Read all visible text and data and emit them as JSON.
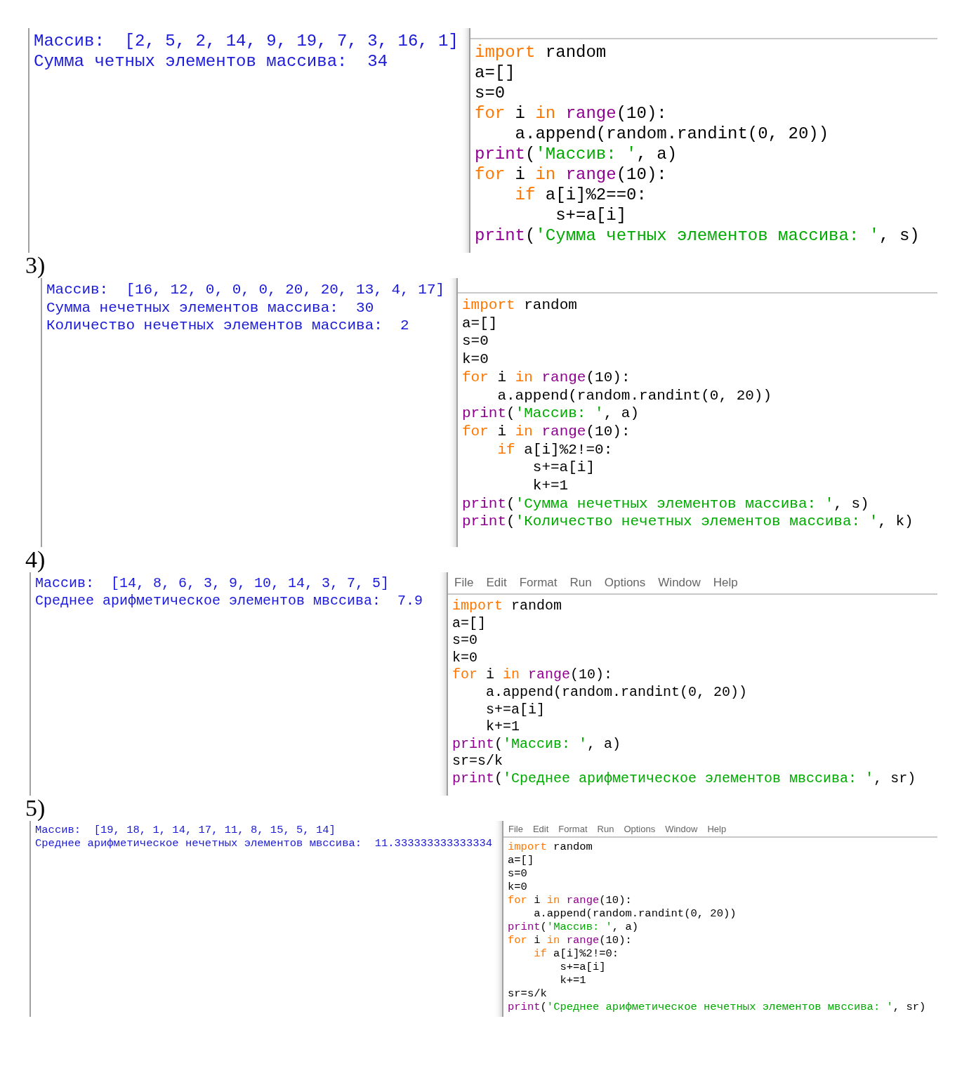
{
  "sections": [
    {
      "shell_output": [
        "Массив:  [2, 5, 2, 14, 9, 19, 7, 3, 16, 1]",
        "Сумма четных элементов массива:  34"
      ],
      "editor": {
        "code": [
          [
            {
              "kind": "keyword",
              "text": "import"
            },
            {
              "kind": "plain",
              "text": " random"
            }
          ],
          [
            {
              "kind": "plain",
              "text": "a=[]"
            }
          ],
          [
            {
              "kind": "plain",
              "text": "s=0"
            }
          ],
          [
            {
              "kind": "keyword",
              "text": "for"
            },
            {
              "kind": "plain",
              "text": " i "
            },
            {
              "kind": "keyword",
              "text": "in"
            },
            {
              "kind": "builtin",
              "text": " range"
            },
            {
              "kind": "plain",
              "text": "(10):"
            }
          ],
          [
            {
              "kind": "plain",
              "text": "    a.append(random.randint(0, 20))"
            }
          ],
          [
            {
              "kind": "builtin",
              "text": "print"
            },
            {
              "kind": "plain",
              "text": "("
            },
            {
              "kind": "string",
              "text": "'Массив: '"
            },
            {
              "kind": "plain",
              "text": ", a)"
            }
          ],
          [
            {
              "kind": "keyword",
              "text": "for"
            },
            {
              "kind": "plain",
              "text": " i "
            },
            {
              "kind": "keyword",
              "text": "in"
            },
            {
              "kind": "builtin",
              "text": " range"
            },
            {
              "kind": "plain",
              "text": "(10):"
            }
          ],
          [
            {
              "kind": "keyword",
              "text": "    if"
            },
            {
              "kind": "plain",
              "text": " a[i]%2==0:"
            }
          ],
          [
            {
              "kind": "plain",
              "text": "        s+=a[i]"
            }
          ],
          [
            {
              "kind": "builtin",
              "text": "print"
            },
            {
              "kind": "plain",
              "text": "("
            },
            {
              "kind": "string",
              "text": "'Сумма четных элементов массива: '"
            },
            {
              "kind": "plain",
              "text": ", s)"
            }
          ]
        ]
      }
    },
    {
      "label": "3)",
      "shell_output": [
        "Массив:  [16, 12, 0, 0, 0, 20, 20, 13, 4, 17]",
        "Сумма нечетных элементов массива:  30",
        "Количество нечетных элементов массива:  2"
      ],
      "editor": {
        "code": [
          [
            {
              "kind": "keyword",
              "text": "import"
            },
            {
              "kind": "plain",
              "text": " random"
            }
          ],
          [
            {
              "kind": "plain",
              "text": "a=[]"
            }
          ],
          [
            {
              "kind": "plain",
              "text": "s=0"
            }
          ],
          [
            {
              "kind": "plain",
              "text": "k=0"
            }
          ],
          [
            {
              "kind": "keyword",
              "text": "for"
            },
            {
              "kind": "plain",
              "text": " i "
            },
            {
              "kind": "keyword",
              "text": "in"
            },
            {
              "kind": "builtin",
              "text": " range"
            },
            {
              "kind": "plain",
              "text": "(10):"
            }
          ],
          [
            {
              "kind": "plain",
              "text": "    a.append(random.randint(0, 20))"
            }
          ],
          [
            {
              "kind": "builtin",
              "text": "print"
            },
            {
              "kind": "plain",
              "text": "("
            },
            {
              "kind": "string",
              "text": "'Массив: '"
            },
            {
              "kind": "plain",
              "text": ", a)"
            }
          ],
          [
            {
              "kind": "keyword",
              "text": "for"
            },
            {
              "kind": "plain",
              "text": " i "
            },
            {
              "kind": "keyword",
              "text": "in"
            },
            {
              "kind": "builtin",
              "text": " range"
            },
            {
              "kind": "plain",
              "text": "(10):"
            }
          ],
          [
            {
              "kind": "keyword",
              "text": "    if"
            },
            {
              "kind": "plain",
              "text": " a[i]%2!=0:"
            }
          ],
          [
            {
              "kind": "plain",
              "text": "        s+=a[i]"
            }
          ],
          [
            {
              "kind": "plain",
              "text": "        k+=1"
            }
          ],
          [
            {
              "kind": "builtin",
              "text": "print"
            },
            {
              "kind": "plain",
              "text": "("
            },
            {
              "kind": "string",
              "text": "'Сумма нечетных элементов массива: '"
            },
            {
              "kind": "plain",
              "text": ", s)"
            }
          ],
          [
            {
              "kind": "builtin",
              "text": "print"
            },
            {
              "kind": "plain",
              "text": "("
            },
            {
              "kind": "string",
              "text": "'Количество нечетных элементов массива: '"
            },
            {
              "kind": "plain",
              "text": ", k)"
            }
          ]
        ]
      }
    },
    {
      "label": "4)",
      "shell_output": [
        "Массив:  [14, 8, 6, 3, 9, 10, 14, 3, 7, 5]",
        "Среднее арифметическое элементов мвссива:  7.9"
      ],
      "editor": {
        "menu": [
          "File",
          "Edit",
          "Format",
          "Run",
          "Options",
          "Window",
          "Help"
        ],
        "code": [
          [
            {
              "kind": "keyword",
              "text": "import"
            },
            {
              "kind": "plain",
              "text": " random"
            }
          ],
          [
            {
              "kind": "plain",
              "text": "a=[]"
            }
          ],
          [
            {
              "kind": "plain",
              "text": "s=0"
            }
          ],
          [
            {
              "kind": "plain",
              "text": "k=0"
            }
          ],
          [
            {
              "kind": "keyword",
              "text": "for"
            },
            {
              "kind": "plain",
              "text": " i "
            },
            {
              "kind": "keyword",
              "text": "in"
            },
            {
              "kind": "builtin",
              "text": " range"
            },
            {
              "kind": "plain",
              "text": "(10):"
            }
          ],
          [
            {
              "kind": "plain",
              "text": "    a.append(random.randint(0, 20))"
            }
          ],
          [
            {
              "kind": "plain",
              "text": "    s+=a[i]"
            }
          ],
          [
            {
              "kind": "plain",
              "text": "    k+=1"
            }
          ],
          [
            {
              "kind": "builtin",
              "text": "print"
            },
            {
              "kind": "plain",
              "text": "("
            },
            {
              "kind": "string",
              "text": "'Массив: '"
            },
            {
              "kind": "plain",
              "text": ", a)"
            }
          ],
          [
            {
              "kind": "plain",
              "text": "sr=s/k"
            }
          ],
          [
            {
              "kind": "builtin",
              "text": "print"
            },
            {
              "kind": "plain",
              "text": "("
            },
            {
              "kind": "string",
              "text": "'Среднее арифметическое элементов мвссива: '"
            },
            {
              "kind": "plain",
              "text": ", sr)"
            }
          ]
        ]
      }
    },
    {
      "label": "5)",
      "shell_output": [
        "Массив:  [19, 18, 1, 14, 17, 11, 8, 15, 5, 14]",
        "Среднее арифметическое нечетных элементов мвссива:  11.333333333333334"
      ],
      "editor": {
        "menu": [
          "File",
          "Edit",
          "Format",
          "Run",
          "Options",
          "Window",
          "Help"
        ],
        "code": [
          [
            {
              "kind": "keyword",
              "text": "import"
            },
            {
              "kind": "plain",
              "text": " random"
            }
          ],
          [
            {
              "kind": "plain",
              "text": "a=[]"
            }
          ],
          [
            {
              "kind": "plain",
              "text": "s=0"
            }
          ],
          [
            {
              "kind": "plain",
              "text": "k=0"
            }
          ],
          [
            {
              "kind": "keyword",
              "text": "for"
            },
            {
              "kind": "plain",
              "text": " i "
            },
            {
              "kind": "keyword",
              "text": "in"
            },
            {
              "kind": "builtin",
              "text": " range"
            },
            {
              "kind": "plain",
              "text": "(10):"
            }
          ],
          [
            {
              "kind": "plain",
              "text": "    a.append(random.randint(0, 20))"
            }
          ],
          [
            {
              "kind": "builtin",
              "text": "print"
            },
            {
              "kind": "plain",
              "text": "("
            },
            {
              "kind": "string",
              "text": "'Массив: '"
            },
            {
              "kind": "plain",
              "text": ", a)"
            }
          ],
          [
            {
              "kind": "keyword",
              "text": "for"
            },
            {
              "kind": "plain",
              "text": " i "
            },
            {
              "kind": "keyword",
              "text": "in"
            },
            {
              "kind": "builtin",
              "text": " range"
            },
            {
              "kind": "plain",
              "text": "(10):"
            }
          ],
          [
            {
              "kind": "keyword",
              "text": "    if"
            },
            {
              "kind": "plain",
              "text": " a[i]%2!=0:"
            }
          ],
          [
            {
              "kind": "plain",
              "text": "        s+=a[i]"
            }
          ],
          [
            {
              "kind": "plain",
              "text": "        k+=1"
            }
          ],
          [
            {
              "kind": "plain",
              "text": "sr=s/k"
            }
          ],
          [
            {
              "kind": "builtin",
              "text": "print"
            },
            {
              "kind": "plain",
              "text": "("
            },
            {
              "kind": "string",
              "text": "'Среднее арифметическое нечетных элементов мвссива: '"
            },
            {
              "kind": "plain",
              "text": ", sr)"
            }
          ]
        ]
      }
    }
  ]
}
